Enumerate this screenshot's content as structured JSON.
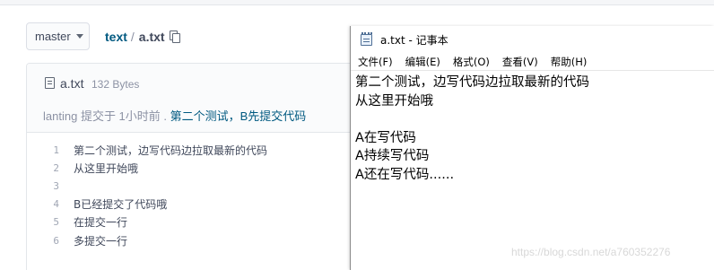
{
  "repo": {
    "branch": "master",
    "path_root": "text",
    "path_sep": "/",
    "path_file": "a.txt",
    "file": {
      "name": "a.txt",
      "size": "132 Bytes",
      "commit_author": "lanting",
      "commit_text": "提交于 1小时前 .",
      "commit_message": "第二个测试，B先提交代码"
    },
    "lines": [
      {
        "num": "1",
        "text": "第二个测试，边写代码边拉取最新的代码"
      },
      {
        "num": "2",
        "text": "从这里开始哦"
      },
      {
        "num": "3",
        "text": ""
      },
      {
        "num": "4",
        "text": "B已经提交了代码哦"
      },
      {
        "num": "5",
        "text": "在提交一行"
      },
      {
        "num": "6",
        "text": "多提交一行"
      }
    ]
  },
  "notepad": {
    "title": "a.txt - 记事本",
    "menu": [
      "文件(F)",
      "编辑(E)",
      "格式(O)",
      "查看(V)",
      "帮助(H)"
    ],
    "lines": [
      "第二个测试，边写代码边拉取最新的代码",
      "从这里开始哦",
      "",
      "A在写代码",
      "A持续写代码",
      "A还在写代码......"
    ]
  },
  "watermark": "https://blog.csdn.net/a760352276"
}
